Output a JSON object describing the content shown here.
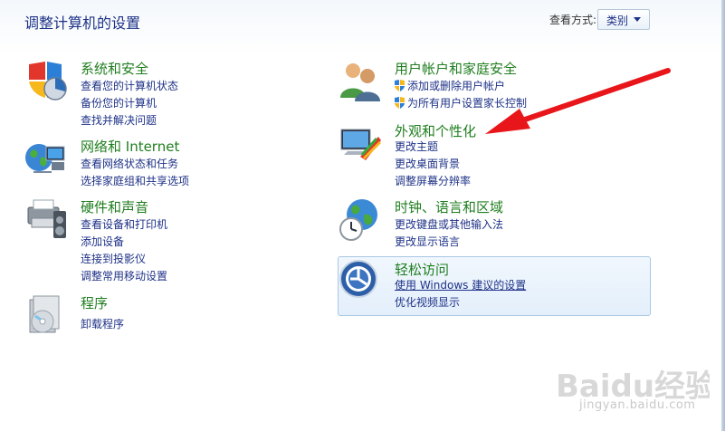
{
  "page": {
    "title": "调整计算机的设置"
  },
  "view_by": {
    "label": "查看方式:",
    "value": "类别"
  },
  "categories": {
    "system": {
      "title": "系统和安全",
      "links": [
        "查看您的计算机状态",
        "备份您的计算机",
        "查找并解决问题"
      ]
    },
    "network": {
      "title": "网络和 Internet",
      "links": [
        "查看网络状态和任务",
        "选择家庭组和共享选项"
      ]
    },
    "hardware": {
      "title": "硬件和声音",
      "links": [
        "查看设备和打印机",
        "添加设备",
        "连接到投影仪",
        "调整常用移动设置"
      ]
    },
    "programs": {
      "title": "程序",
      "links": [
        "卸载程序"
      ]
    },
    "users": {
      "title": "用户帐户和家庭安全",
      "links": [
        "添加或删除用户帐户",
        "为所有用户设置家长控制"
      ]
    },
    "appearance": {
      "title": "外观和个性化",
      "links": [
        "更改主题",
        "更改桌面背景",
        "调整屏幕分辨率"
      ]
    },
    "clock": {
      "title": "时钟、语言和区域",
      "links": [
        "更改键盘或其他输入法",
        "更改显示语言"
      ]
    },
    "ease": {
      "title": "轻松访问",
      "links": [
        "使用 Windows 建议的设置",
        "优化视频显示"
      ]
    }
  },
  "watermark": {
    "logo": "Baidu经验",
    "text": "jingyan.baidu.com"
  },
  "colors": {
    "title": "#1f7e1f",
    "link": "#1e3287",
    "arrow": "#e8161b"
  }
}
